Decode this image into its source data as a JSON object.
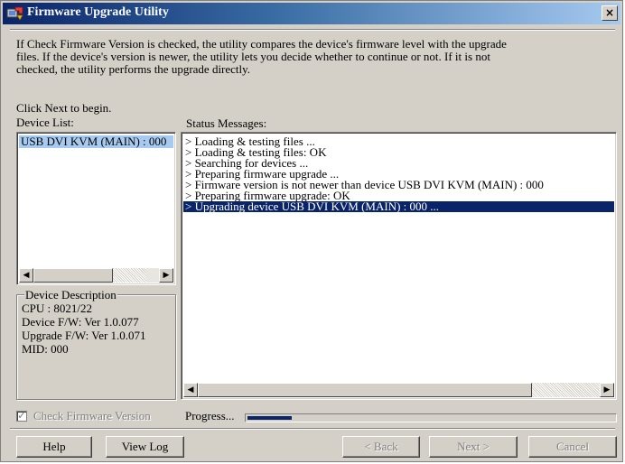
{
  "window": {
    "title": "Firmware Upgrade Utility",
    "close_glyph": "×"
  },
  "intro": {
    "line1": "If Check Firmware Version is checked, the utility compares the device's firmware level with the upgrade",
    "line2": "files. If the device's version is newer, the utility lets you decide whether to continue or not. If it is not",
    "line3": "checked, the utility performs the upgrade directly.",
    "begin": "Click Next to begin."
  },
  "device_list": {
    "label": "Device List:",
    "items": [
      "USB DVI KVM (MAIN) : 000"
    ],
    "selected_index": 0
  },
  "status": {
    "label": "Status Messages:",
    "messages": [
      "> Loading & testing files ...",
      "> Loading & testing files: OK",
      "> Searching for devices ...",
      "> Preparing firmware upgrade ...",
      "> Firmware version is not newer than device USB DVI KVM (MAIN) : 000",
      "> Preparing firmware upgrade: OK",
      "> Upgrading device USB DVI KVM (MAIN) : 000 ..."
    ],
    "selected_index": 6
  },
  "device_description": {
    "legend": "Device Description",
    "cpu": "CPU : 8021/22",
    "device_fw": "Device F/W: Ver 1.0.077",
    "upgrade_fw": "Upgrade F/W: Ver 1.0.071",
    "mid": "MID: 000"
  },
  "check_firmware": {
    "label": "Check Firmware Version",
    "checked": true,
    "enabled": false
  },
  "progress": {
    "label": "Progress...",
    "fraction": 0.12
  },
  "buttons": {
    "help": "Help",
    "view_log": "View Log",
    "back": "< Back",
    "next": "Next >",
    "cancel": "Cancel"
  },
  "colors": {
    "selection": "#0a246a",
    "device_selection": "#a6caf0",
    "face": "#d4d0c8",
    "title_start": "#0a246a",
    "title_end": "#a6caf0"
  },
  "icons": {
    "app": "firmware-app-icon",
    "close": "close-icon",
    "scroll_left": "arrow-left-icon",
    "scroll_right": "arrow-right-icon",
    "check": "checkmark-icon"
  }
}
